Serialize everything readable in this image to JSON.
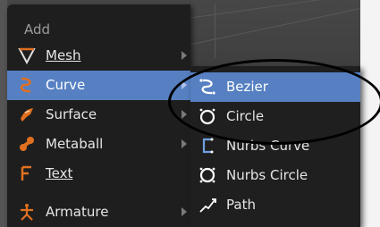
{
  "menu": {
    "title": "Add",
    "items": [
      {
        "label": "Mesh",
        "icon": "mesh-icon",
        "has_submenu": true,
        "active": false
      },
      {
        "label": "Curve",
        "icon": "curve-icon",
        "has_submenu": true,
        "active": true
      },
      {
        "label": "Surface",
        "icon": "surface-icon",
        "has_submenu": true,
        "active": false
      },
      {
        "label": "Metaball",
        "icon": "metaball-icon",
        "has_submenu": true,
        "active": false
      },
      {
        "label": "Text",
        "icon": "text-icon",
        "has_submenu": false,
        "active": false
      },
      {
        "label": "Armature",
        "icon": "armature-icon",
        "has_submenu": true,
        "active": false
      }
    ]
  },
  "submenu": {
    "items": [
      {
        "label": "Bezier",
        "icon": "bezier-icon",
        "active": true
      },
      {
        "label": "Circle",
        "icon": "circle-icon",
        "active": false
      },
      {
        "label": "Nurbs Curve",
        "icon": "nurbs-curve-icon",
        "active": false
      },
      {
        "label": "Nurbs Circle",
        "icon": "nurbs-circle-icon",
        "active": false
      },
      {
        "label": "Path",
        "icon": "path-icon",
        "active": false
      }
    ]
  },
  "colors": {
    "menu_bg": "#1e1e1e",
    "highlight": "#5680c2",
    "text": "#e6e6e6",
    "title_text": "#9b9b9b"
  }
}
